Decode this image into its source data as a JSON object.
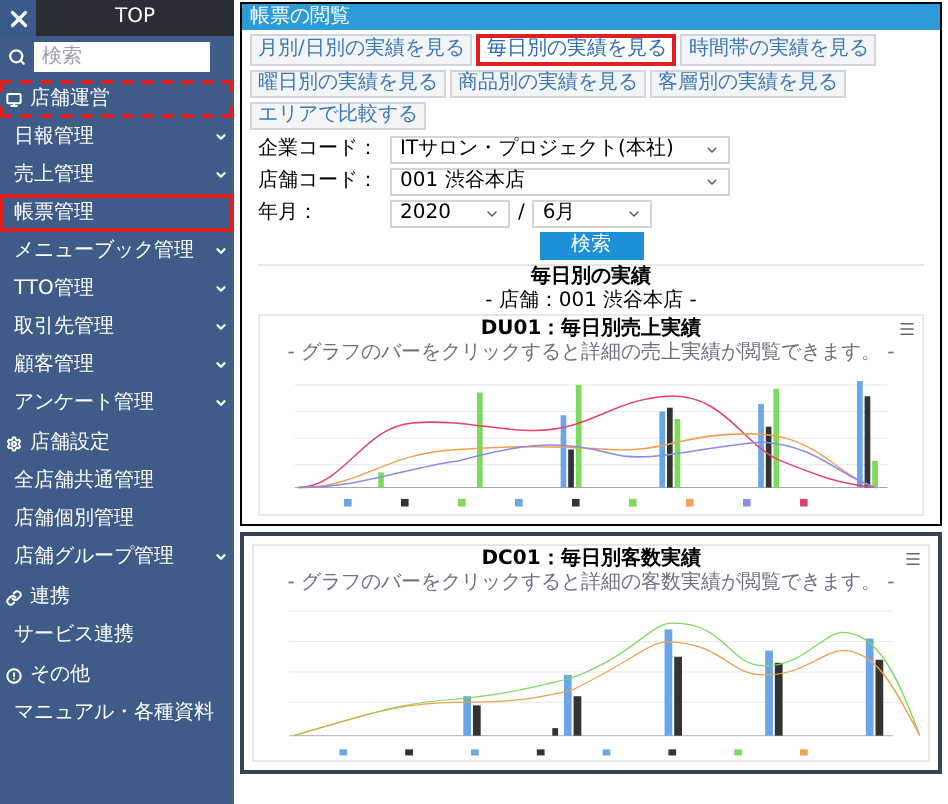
{
  "sidebar": {
    "header": "TOP",
    "search": {
      "placeholder": "検索"
    },
    "items": [
      {
        "kind": "section",
        "label": "店舗運営",
        "caret": false,
        "highlighted": true
      },
      {
        "kind": "item",
        "label": "日報管理",
        "caret": true,
        "highlighted": false
      },
      {
        "kind": "item",
        "label": "売上管理",
        "caret": true,
        "highlighted": false
      },
      {
        "kind": "item",
        "label": "帳票管理",
        "caret": false,
        "highlighted": true
      },
      {
        "kind": "item",
        "label": "メニューブック管理",
        "caret": true,
        "highlighted": false
      },
      {
        "kind": "item",
        "label": "TTO管理",
        "caret": true,
        "highlighted": false
      },
      {
        "kind": "item",
        "label": "取引先管理",
        "caret": true,
        "highlighted": false
      },
      {
        "kind": "item",
        "label": "顧客管理",
        "caret": true,
        "highlighted": false
      },
      {
        "kind": "item",
        "label": "アンケート管理",
        "caret": true,
        "highlighted": false
      },
      {
        "kind": "section",
        "label": "店舗設定",
        "caret": false,
        "highlighted": false
      },
      {
        "kind": "item",
        "label": "全店舗共通管理",
        "caret": false,
        "highlighted": false
      },
      {
        "kind": "item",
        "label": "店舗個別管理",
        "caret": false,
        "highlighted": false
      },
      {
        "kind": "item",
        "label": "店舗グループ管理",
        "caret": true,
        "highlighted": false
      },
      {
        "kind": "section",
        "label": "連携",
        "caret": false,
        "highlighted": false
      },
      {
        "kind": "item",
        "label": "サービス連携",
        "caret": false,
        "highlighted": false
      },
      {
        "kind": "section",
        "label": "その他",
        "caret": false,
        "highlighted": false
      },
      {
        "kind": "item",
        "label": "マニュアル・各種資料",
        "caret": false,
        "highlighted": false
      }
    ]
  },
  "panel": {
    "title": "帳票の閲覧",
    "tabs": [
      {
        "label": "月別/日別の実績を見る",
        "selected": false
      },
      {
        "label": "毎日別の実績を見る",
        "selected": true
      },
      {
        "label": "時間帯の実績を見る",
        "selected": false
      },
      {
        "label": "曜日別の実績を見る",
        "selected": false
      },
      {
        "label": "商品別の実績を見る",
        "selected": false
      },
      {
        "label": "客層別の実績を見る",
        "selected": false
      },
      {
        "label": "エリアで比較する",
        "selected": false
      }
    ],
    "fields": [
      {
        "label": "企業コード：",
        "selects": [
          "ITサロン・プロジェクト(本社)"
        ]
      },
      {
        "label": "店舗コード：",
        "selects": [
          "001 渋谷本店"
        ]
      },
      {
        "label": "年月：",
        "selects": [
          "2020",
          "6月"
        ],
        "separator": "/"
      }
    ],
    "button": "検索",
    "heading": "毎日別の実績",
    "subheading": "- 店舗：001 渋谷本店 -",
    "chart": {
      "title": "DU01：毎日別売上実績",
      "subtitle": "- グラフのバーをクリックすると詳細の売上実績が閲覧できます。 -"
    }
  },
  "detail": {
    "chart": {
      "title": "DC01：毎日別客数実績",
      "subtitle": "- グラフのバーをクリックすると詳細の客数実績が閲覧できます。 -"
    }
  }
}
